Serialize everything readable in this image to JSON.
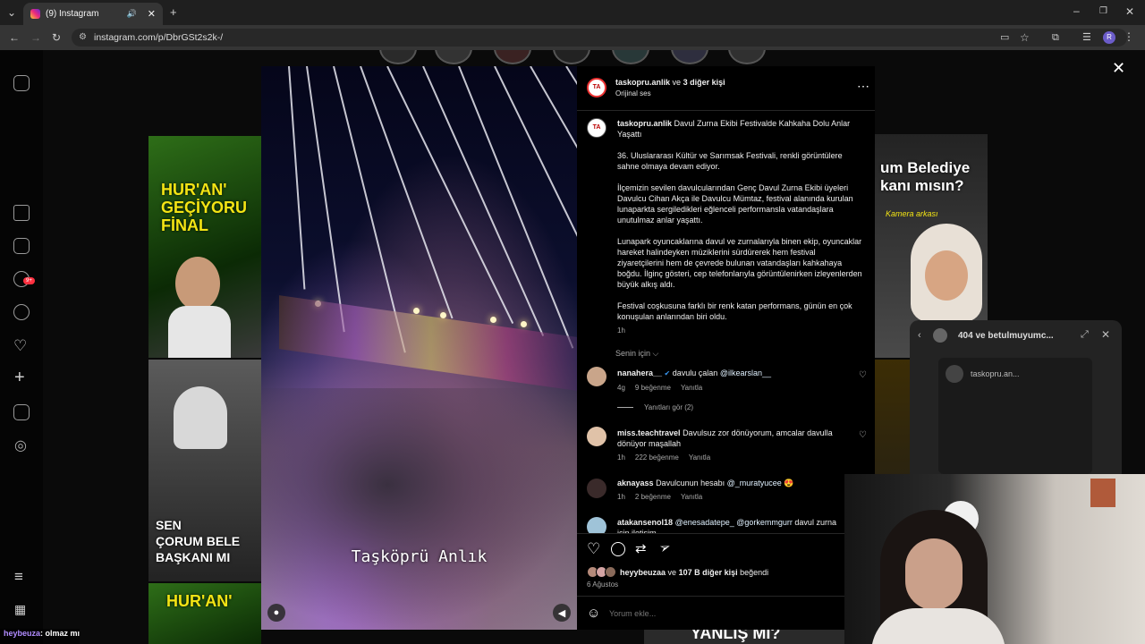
{
  "browser": {
    "tab_title": "(9) Instagram",
    "url": "instagram.com/p/DbrGSt2s2k-/",
    "profile_initial": "R"
  },
  "thumbnails": {
    "t1_text": "HUR'AN'\nGEÇİYORU\nFİNAL",
    "t2_text": "SEN\nÇORUM BELE\nBAŞKANI MI",
    "t3_text": "HUR'AN'",
    "t4_text": "um Belediye\nkanı mısın?",
    "t4_sub": "Kamera arkası",
    "bottom_right_text": "YANLIŞ MI?"
  },
  "video": {
    "overlay_text": "Taşköprü Anlık",
    "avatar_badge": "TA"
  },
  "post": {
    "header_user": "taskopru.anlik",
    "header_connector": "ve",
    "header_others": "3 diğer kişi",
    "audio": "Orijinal ses",
    "caption_user": "taskopru.anlik",
    "caption_title": "Davul Zurna Ekibi Festivalde Kahkaha Dolu Anlar Yaşattı",
    "caption_p1": "36. Uluslararası Kültür ve Sarımsak Festivali, renkli görüntülere sahne olmaya devam ediyor.",
    "caption_p2": "İlçemizin sevilen davulcularından Genç Davul Zurna Ekibi üyeleri Davulcu Cihan Akça ile Davulcu Mümtaz, festival alanında kurulan lunaparkta sergiledikleri eğlenceli performansla vatandaşlara unutulmaz anlar yaşattı.",
    "caption_p3": "Lunapark oyuncaklarına davul ve zurnalarıyla binen ekip, oyuncaklar hareket halindeyken müziklerini sürdürerek hem festival ziyaretçilerini hem de çevrede bulunan vatandaşları kahkahaya boğdu. İlginç gösteri, cep telefonlarıyla görüntülenirken izleyenlerden büyük alkış aldı.",
    "caption_p4": "Festival coşkusuna farklı bir renk katan performans, günün en çok konuşulan anlarından biri oldu.",
    "caption_time": "1h",
    "sort_label": "Senin için",
    "comments": [
      {
        "user": "nanahera__",
        "verified": true,
        "text": "davulu çalan",
        "mention": "@ilkearslan__",
        "time": "4g",
        "likes": "9 beğenme",
        "reply": "Yanıtla"
      },
      {
        "user": "miss.teachtravel",
        "text": "Davulsuz zor dönüyorum, amcalar davulla dönüyor maşallah",
        "time": "1h",
        "likes": "222 beğenme",
        "reply": "Yanıtla"
      },
      {
        "user": "aknayass",
        "text": "Davulcunun hesabı",
        "mention": "@_muratyucee",
        "emoji": "😍",
        "time": "1h",
        "likes": "2 beğenme",
        "reply": "Yanıtla"
      },
      {
        "user": "atakansenol18",
        "mention": "@enesadatepe_ @gorkemmgurr",
        "text": "davul zurna için iletişim"
      }
    ],
    "view_replies": "Yanıtları gör (2)",
    "liked_by_user": "heyybeuzaa",
    "liked_connector": "ve",
    "liked_others": "107 B diğer kişi",
    "liked_suffix": "beğendi",
    "date": "6 Ağustos",
    "comment_placeholder": "Yorum ekle..."
  },
  "mini_player": {
    "title": "404 ve betulmuyumc...",
    "user": "taskopru.an..."
  },
  "chat": {
    "user": "heybeuza",
    "message": ": olmaz mı"
  },
  "notifications_badge": "9+"
}
